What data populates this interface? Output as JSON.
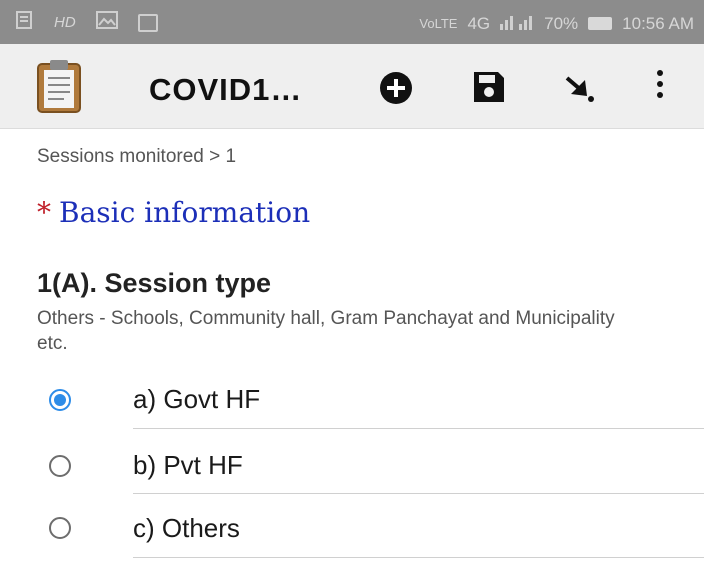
{
  "status_bar": {
    "network_badge": "HD",
    "network_type": "4G",
    "battery": "70%",
    "time": "10:56 AM",
    "colors": {
      "background": "#8c8c8c",
      "text": "#d6d6d6"
    }
  },
  "app_bar": {
    "title": "COVID1…",
    "icons": [
      "clipboard-icon",
      "add-icon",
      "save-icon",
      "go-to-icon",
      "overflow-menu-icon"
    ],
    "colors": {
      "background": "#efefef"
    }
  },
  "breadcrumb": "Sessions monitored > 1",
  "group": {
    "required_marker": "*",
    "title": "Basic information",
    "colors": {
      "title": "#1c2fb8",
      "required": "#c0202a"
    }
  },
  "question": {
    "label": "1(A). Session type",
    "hint": "Others - Schools, Community hall, Gram Panchayat and Municipality etc.",
    "options": [
      {
        "label": "a) Govt HF",
        "selected": true
      },
      {
        "label": "b) Pvt HF",
        "selected": false
      },
      {
        "label": "c) Others",
        "selected": false
      }
    ],
    "colors": {
      "selected_radio": "#2d8ce8"
    }
  }
}
